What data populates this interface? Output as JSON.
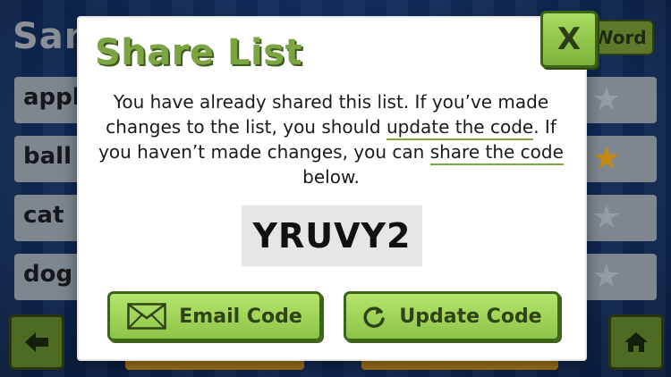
{
  "background": {
    "title": "Sam",
    "word_button": "Word",
    "rows": [
      {
        "label": "appl",
        "starred": false
      },
      {
        "label": "ball",
        "starred": true
      },
      {
        "label": "cat",
        "starred": false
      },
      {
        "label": "dog",
        "starred": false
      }
    ]
  },
  "modal": {
    "title": "Share List",
    "close_label": "X",
    "message": {
      "part1": "You have already shared this list. If you’ve made changes to the list, you should ",
      "update_link": "update the code",
      "part2": ". If you haven’t made changes, you can ",
      "share_link": "share the code",
      "part3": " below."
    },
    "code": "YRUVY2",
    "email_button": "Email Code",
    "update_button": "Update Code"
  },
  "colors": {
    "accent_green": "#7ba442",
    "button_green": "#8cc447",
    "star_gold": "#c28a12"
  }
}
